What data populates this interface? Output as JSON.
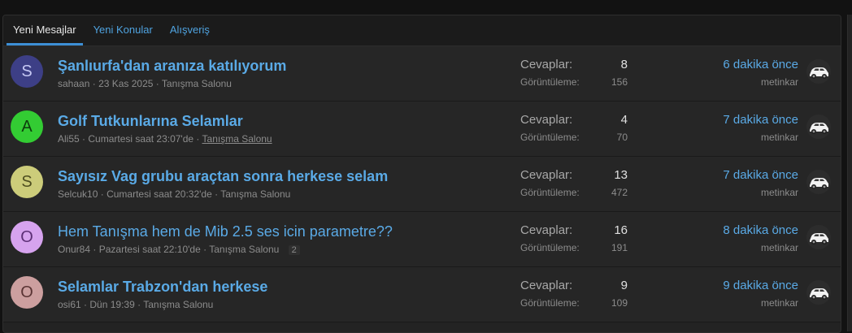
{
  "tabs": [
    {
      "label": "Yeni Mesajlar",
      "active": true
    },
    {
      "label": "Yeni Konular",
      "active": false
    },
    {
      "label": "Alışveriş",
      "active": false
    }
  ],
  "labels": {
    "replies": "Cevaplar:",
    "views": "Görüntüleme:"
  },
  "threads": [
    {
      "avatar_letter": "S",
      "avatar_bg": "#3d3f86",
      "avatar_fg": "#c6c8f4",
      "title": "Şanlıurfa'dan aranıza katılıyorum",
      "bold": true,
      "author": "sahaan",
      "date": "23 Kas 2025",
      "forum": "Tanışma Salonu",
      "pages": "",
      "replies": "8",
      "views": "156",
      "last_time": "6 dakika önce",
      "last_user": "metinkar"
    },
    {
      "avatar_letter": "A",
      "avatar_bg": "#33cc33",
      "avatar_fg": "#0d3d0d",
      "title": "Golf Tutkunlarına Selamlar",
      "bold": true,
      "author": "Ali55",
      "date": "Cumartesi saat 23:07'de",
      "forum": "Tanışma Salonu",
      "pages": "",
      "replies": "4",
      "views": "70",
      "last_time": "7 dakika önce",
      "last_user": "metinkar"
    },
    {
      "avatar_letter": "S",
      "avatar_bg": "#cccc7a",
      "avatar_fg": "#4d4d20",
      "title": "Sayısız Vag grubu araçtan sonra herkese selam",
      "bold": true,
      "author": "Selcuk10",
      "date": "Cumartesi saat 20:32'de",
      "forum": "Tanışma Salonu",
      "pages": "",
      "replies": "13",
      "views": "472",
      "last_time": "7 dakika önce",
      "last_user": "metinkar"
    },
    {
      "avatar_letter": "O",
      "avatar_bg": "#d6a3ee",
      "avatar_fg": "#5c2f75",
      "title": "Hem Tanışma hem de Mib 2.5 ses icin parametre??",
      "bold": false,
      "author": "Onur84",
      "date": "Pazartesi saat 22:10'de",
      "forum": "Tanışma Salonu",
      "pages": "2",
      "replies": "16",
      "views": "191",
      "last_time": "8 dakika önce",
      "last_user": "metinkar"
    },
    {
      "avatar_letter": "O",
      "avatar_bg": "#cc9f9f",
      "avatar_fg": "#5a3434",
      "title": "Selamlar Trabzon'dan herkese",
      "bold": true,
      "author": "osi61",
      "date": "Dün 19:39",
      "forum": "Tanışma Salonu",
      "pages": "",
      "replies": "9",
      "views": "109",
      "last_time": "9 dakika önce",
      "last_user": "metinkar"
    }
  ]
}
